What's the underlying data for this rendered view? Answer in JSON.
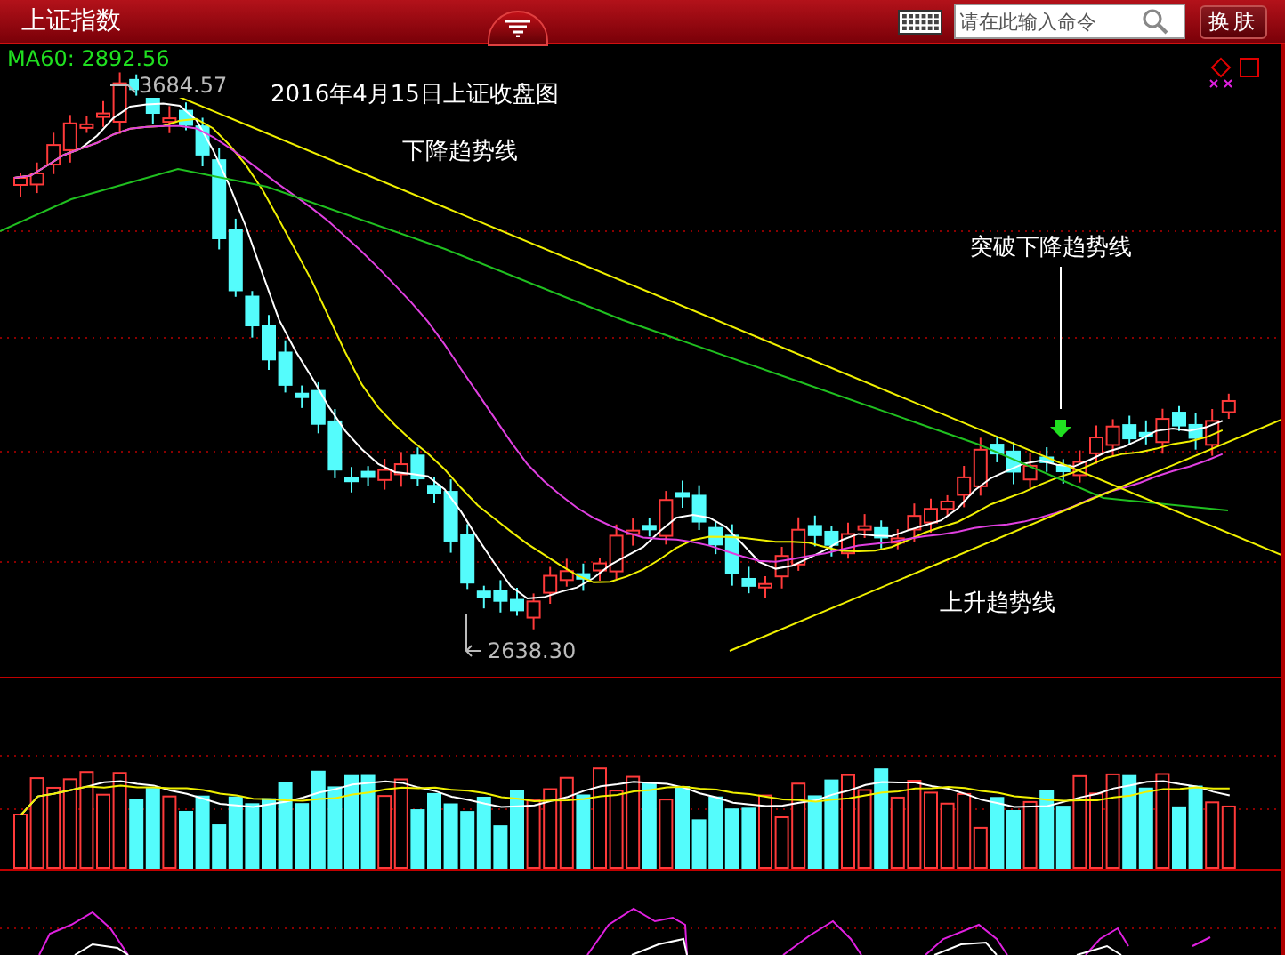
{
  "window": {
    "title": "上证指数"
  },
  "search": {
    "placeholder": "请在此输入命令"
  },
  "buttons": [
    {
      "label": "换肤"
    }
  ],
  "chart": {
    "ma_label": "MA60: 2892.56",
    "high_label": "3684.57",
    "low_label": "2638.30",
    "annotations": [
      {
        "text": "2016年4月15日上证收盘图"
      },
      {
        "text": "下降趋势线"
      },
      {
        "text": "突破下降趋势线"
      },
      {
        "text": "上升趋势线"
      }
    ]
  }
}
